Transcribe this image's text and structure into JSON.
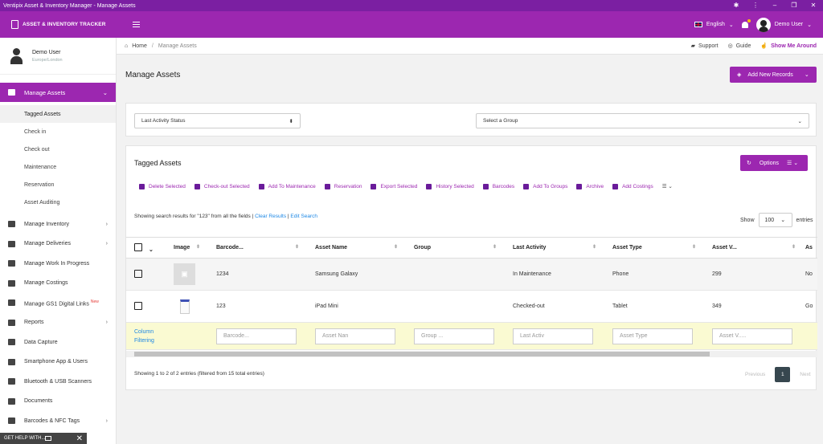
{
  "window": {
    "title": "Ventipix Asset & Inventory Manager - Manage Assets"
  },
  "topbar": {
    "brand": "ASSET & INVENTORY TRACKER",
    "language": "English",
    "user": "Demo User"
  },
  "sidebar": {
    "user": {
      "name": "Demo User",
      "location": "Europe/London"
    },
    "active": "Manage Assets",
    "subitems": [
      "Tagged Assets",
      "Check in",
      "Check out",
      "Maintenance",
      "Reservation",
      "Asset Auditing"
    ],
    "items": [
      {
        "label": "Manage Inventory",
        "chev": "›"
      },
      {
        "label": "Manage Deliveries",
        "chev": "›"
      },
      {
        "label": "Manage Work In Progress",
        "chev": ""
      },
      {
        "label": "Manage Costings",
        "chev": ""
      },
      {
        "label": "Manage GS1 Digital Links",
        "chev": "",
        "badge": "New"
      },
      {
        "label": "Reports",
        "chev": "›"
      },
      {
        "label": "Data Capture",
        "chev": ""
      },
      {
        "label": "Smartphone App & Users",
        "chev": ""
      },
      {
        "label": "Bluetooth & USB Scanners",
        "chev": ""
      },
      {
        "label": "Documents",
        "chev": ""
      },
      {
        "label": "Barcodes & NFC Tags",
        "chev": "›"
      }
    ],
    "gethelp": "GET HELP WITH..."
  },
  "breadcrumb": {
    "home": "Home",
    "current": "Manage Assets",
    "support": "Support",
    "guide": "Guide",
    "show_me": "Show Me Around"
  },
  "page": {
    "title": "Manage Assets",
    "add_button": "Add New Records"
  },
  "filters": {
    "activity": "Last Activity Status",
    "group": "Select a Group"
  },
  "panel": {
    "title": "Tagged Assets",
    "options": "Options",
    "toolbar": [
      "Delete Selected",
      "Check-out Selected",
      "Add To Maintenance",
      "Reservation",
      "Export Selected",
      "History Selected",
      "Barcodes",
      "Add To Groups",
      "Archive",
      "Add Costings"
    ],
    "search_info": "Showing search results for \"123\" from all the fields | ",
    "clear": "Clear Results",
    "edit": "Edit Search",
    "show_label": "Show",
    "show_value": "100",
    "entries_label": "entries",
    "columns": [
      "Image",
      "Barcode...",
      "Asset Name",
      "Group",
      "Last Activity",
      "Asset Type",
      "Asset V...",
      "As"
    ],
    "rows": [
      {
        "barcode": "1234",
        "name": "Samsung Galaxy",
        "group": "",
        "activity": "In Maintenance",
        "type": "Phone",
        "value": "299",
        "extra": "No"
      },
      {
        "barcode": "123",
        "name": "iPad Mini",
        "group": "",
        "activity": "Checked-out",
        "type": "Tablet",
        "value": "349",
        "extra": "Go"
      }
    ],
    "column_filtering": "Column Filtering",
    "filter_placeholders": [
      "Barcode...",
      "Asset Nan",
      "Group ...",
      "Last Activ",
      "Asset Type",
      "Asset V....."
    ],
    "footer": "Showing 1 to 2 of 2 entries (filtered from 15 total entries)",
    "pager": {
      "prev": "Previous",
      "page": "1",
      "next": "Next"
    }
  }
}
